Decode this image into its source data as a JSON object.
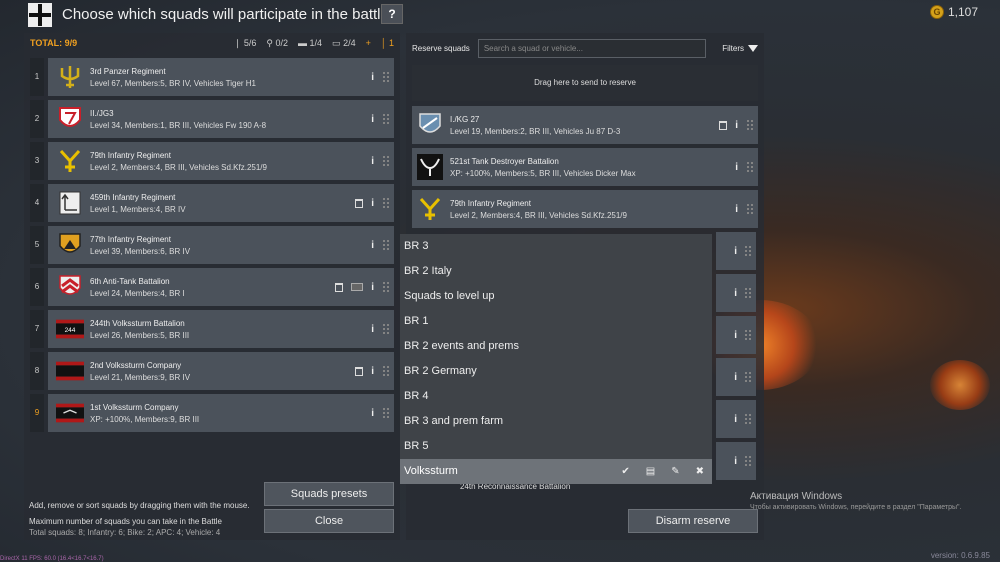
{
  "header": {
    "title": "Choose which squads will participate in the battle",
    "help_label": "?",
    "gold_amount": "1,107",
    "coin_glyph": "G"
  },
  "left": {
    "total_label": "TOTAL: 9/9",
    "counts": {
      "infantry": "5/6",
      "bike": "0/2",
      "vehicle": "1/4",
      "apc": "2/4",
      "plus": "+",
      "extra": "1"
    },
    "squads": [
      {
        "num": "1",
        "name": "3rd Panzer Regiment",
        "info": "Level 67, Members:5, BR IV, Vehicles Tiger H1",
        "icon": "tank-icon",
        "emblem_color": "#d4b01a",
        "trash": false
      },
      {
        "num": "2",
        "name": "II./JG3",
        "info": "Level 34, Members:1, BR III, Vehicles Fw 190 A-8",
        "icon": "plane-icon",
        "emblem_color": "#c8202a",
        "trash": false
      },
      {
        "num": "3",
        "name": "79th Infantry Regiment",
        "info": "Level 2, Members:4, BR III, Vehicles Sd.Kfz.251/9",
        "icon": "apc-icon",
        "emblem_color": "#e8c000",
        "trash": false
      },
      {
        "num": "4",
        "name": "459th Infantry Regiment",
        "info": "Level 1, Members:4, BR IV",
        "icon": "flame-icon",
        "emblem_color": "#dddddd",
        "trash": true
      },
      {
        "num": "5",
        "name": "77th Infantry Regiment",
        "info": "Level 39, Members:6, BR IV",
        "icon": "flame-icon",
        "emblem_color": "#e0a020",
        "trash": false
      },
      {
        "num": "6",
        "name": "6th Anti-Tank Battalion",
        "info": "Level 24, Members:4, BR I",
        "icon": "flame-icon",
        "emblem_color": "#c8202a",
        "trash": true
      },
      {
        "num": "7",
        "name": "244th Volkssturm Battalion",
        "info": "Level 26, Members:5, BR III",
        "icon": "bike-icon",
        "emblem_color": "#b01818",
        "trash": false
      },
      {
        "num": "8",
        "name": "2nd Volkssturm Company",
        "info": "Level 21, Members:9, BR IV",
        "icon": "rifle-icon",
        "emblem_color": "#b01818",
        "trash": true
      },
      {
        "num": "9",
        "name": "1st Volkssturm Company",
        "info": "XP: +100%, Members:9, BR III",
        "icon": "rifle-icon",
        "emblem_color": "#b01818",
        "trash": false
      }
    ],
    "emblem_7_text": "244",
    "info_glyph": "i",
    "arrows": {
      "up": "↑",
      "down": "↓",
      "right": "→"
    },
    "help_lines": [
      "Add, remove or sort squads by dragging them with the mouse.",
      "Maximum number of squads you can take in the Battle",
      "Total squads: 8; Infantry: 6; Bike: 2; APC: 4; Vehicle: 4"
    ],
    "presets_label": "Squads presets",
    "close_label": "Close"
  },
  "right": {
    "reserve_label": "Reserve squads",
    "search_placeholder": "Search a squad or vehicle...",
    "filters_label": "Filters",
    "drop_zone_text": "Drag here to send to reserve",
    "reserve": [
      {
        "name": "I./KG 27",
        "info": "Level 19, Members:2, BR III, Vehicles Ju 87 D-3",
        "icon": "plane-icon",
        "emblem_color": "#6a8fb0",
        "trash": true
      },
      {
        "name": "521st Tank Destroyer Battalion",
        "info": "XP: +100%, Members:5, BR III, Vehicles Dicker Max",
        "icon": "tank-icon",
        "emblem_color": "#111111",
        "trash": false
      },
      {
        "name": "79th Infantry Regiment",
        "info": "Level 2, Members:4, BR III, Vehicles Sd.Kfz.251/9",
        "icon": "apc-icon",
        "emblem_color": "#e8c000",
        "trash": false
      }
    ],
    "partial_row": "24th Reconnaissance Battalion",
    "disarm_label": "Disarm reserve"
  },
  "dropdown": {
    "items": [
      "BR 3",
      "BR 2 Italy",
      "Squads to level up",
      "BR 1",
      "BR 2 events and prems",
      "BR 2 Germany",
      "BR 4",
      "BR 3 and prem farm",
      "BR 5",
      "Volkssturm"
    ],
    "active_index": 9,
    "actions": {
      "check": "✔",
      "save": "▤",
      "edit": "✎",
      "delete": "✖"
    }
  },
  "watermark": {
    "title": "Активация Windows",
    "subtitle": "Чтобы активировать Windows, перейдите в раздел \"Параметры\"."
  },
  "version": "version: 0.6.9.85",
  "fps": "DirectX 11 FPS: 60.0 (16.4<16.7<16.7)"
}
